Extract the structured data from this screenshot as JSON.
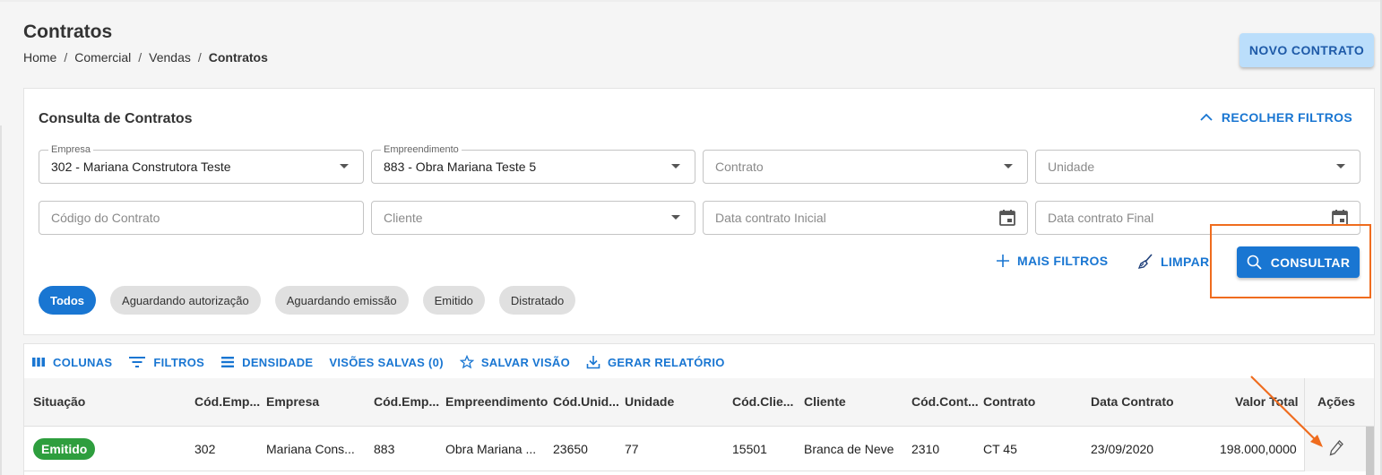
{
  "header": {
    "title": "Contratos",
    "breadcrumb": [
      "Home",
      "Comercial",
      "Vendas",
      "Contratos"
    ],
    "new_button": "NOVO CONTRATO"
  },
  "filters": {
    "title": "Consulta de Contratos",
    "collapse_label": "RECOLHER FILTROS",
    "empresa": {
      "label": "Empresa",
      "value": "302 - Mariana Construtora Teste"
    },
    "empreendimento": {
      "label": "Empreendimento",
      "value": "883 - Obra Mariana Teste 5"
    },
    "contrato_placeholder": "Contrato",
    "unidade_placeholder": "Unidade",
    "codigo_placeholder": "Código do Contrato",
    "cliente_placeholder": "Cliente",
    "data_inicial_placeholder": "Data contrato Inicial",
    "data_final_placeholder": "Data contrato Final",
    "more_filters": "MAIS FILTROS",
    "clear": "LIMPAR",
    "search": "CONSULTAR",
    "status_chips": [
      "Todos",
      "Aguardando autorização",
      "Aguardando emissão",
      "Emitido",
      "Distratado"
    ]
  },
  "grid": {
    "toolbar": {
      "columns": "COLUNAS",
      "filters": "FILTROS",
      "density": "DENSIDADE",
      "saved_views": "VISÕES SALVAS (0)",
      "save_view": "SALVAR VISÃO",
      "report": "GERAR RELATÓRIO"
    },
    "headers": [
      "Situação",
      "Cód.Emp...",
      "Empresa",
      "Cód.Emp...",
      "Empreendimento",
      "Cód.Unid...",
      "Unidade",
      "Cód.Clie...",
      "Cliente",
      "Cód.Cont...",
      "Contrato",
      "Data Contrato",
      "Valor Total",
      "Ações"
    ],
    "rows": [
      {
        "situacao": "Emitido",
        "cod_empresa": "302",
        "empresa": "Mariana Cons...",
        "cod_empreendimento": "883",
        "empreendimento": "Obra Mariana ...",
        "cod_unidade": "23650",
        "unidade": "77",
        "cod_cliente": "15501",
        "cliente": "Branca de Neve",
        "cod_contrato": "2310",
        "contrato": "CT 45",
        "data_contrato": "23/09/2020",
        "valor_total": "198.000,0000"
      }
    ]
  },
  "colors": {
    "primary": "#1976d2",
    "success": "#2e9e3e",
    "highlight": "#ef6c1e"
  }
}
